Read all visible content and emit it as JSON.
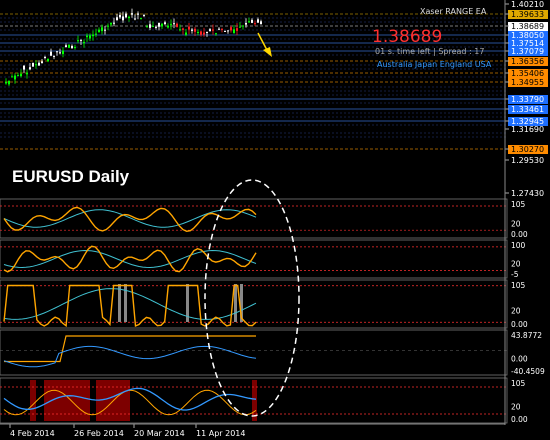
{
  "header": {
    "ea_name": "Xaser RANGE EA",
    "price": "1.38689",
    "countdown_label": "01 s. time left | Spread : 17",
    "sessions": "Australia  Japan  England  USA"
  },
  "chart_title": "EURUSD  Daily",
  "price_scale": [
    {
      "value": "1.40210",
      "kind": "plain"
    },
    {
      "value": "1.39633",
      "kind": "yellow"
    },
    {
      "value": "1.38689",
      "kind": "white"
    },
    {
      "value": "1.38050",
      "kind": "blue"
    },
    {
      "value": "1.37514",
      "kind": "blue"
    },
    {
      "value": "1.37079",
      "kind": "blue"
    },
    {
      "value": "1.36356",
      "kind": "orange"
    },
    {
      "value": "1.35406",
      "kind": "orange"
    },
    {
      "value": "1.34955",
      "kind": "orange"
    },
    {
      "value": "1.33790",
      "kind": "blue"
    },
    {
      "value": "1.33461",
      "kind": "blue"
    },
    {
      "value": "1.32945",
      "kind": "blue"
    },
    {
      "value": "1.31690",
      "kind": "plain"
    },
    {
      "value": "1.30270",
      "kind": "orange"
    },
    {
      "value": "1.29530",
      "kind": "plain"
    },
    {
      "value": "1.27430",
      "kind": "plain"
    }
  ],
  "panels": [
    {
      "name": "indicator-panel-1",
      "top": "105",
      "bottom": "0.00",
      "mid": "20"
    },
    {
      "name": "indicator-panel-2",
      "top": "100",
      "bottom": "-5",
      "mid": "20"
    },
    {
      "name": "indicator-panel-3",
      "top": "105",
      "bottom": "0.00",
      "mid": "20"
    },
    {
      "name": "indicator-panel-4",
      "top": "43.8772",
      "bottom": "-40.4509",
      "mid": "0.00"
    },
    {
      "name": "indicator-panel-5",
      "top": "105",
      "bottom": "0.00",
      "mid": "20"
    }
  ],
  "x_axis": [
    "4 Feb 2014",
    "26 Feb 2014",
    "20 Mar 2014",
    "11 Apr 2014"
  ],
  "colors": {
    "background": "#000000",
    "bull_candle": "#00ff00",
    "bear_candle": "#ffffff",
    "price_red": "#ff2020",
    "orange_line": "#ffa500",
    "cyan_line": "#40c0d0",
    "blue_line": "#3399ff",
    "dark_red_band": "#8b0000"
  }
}
